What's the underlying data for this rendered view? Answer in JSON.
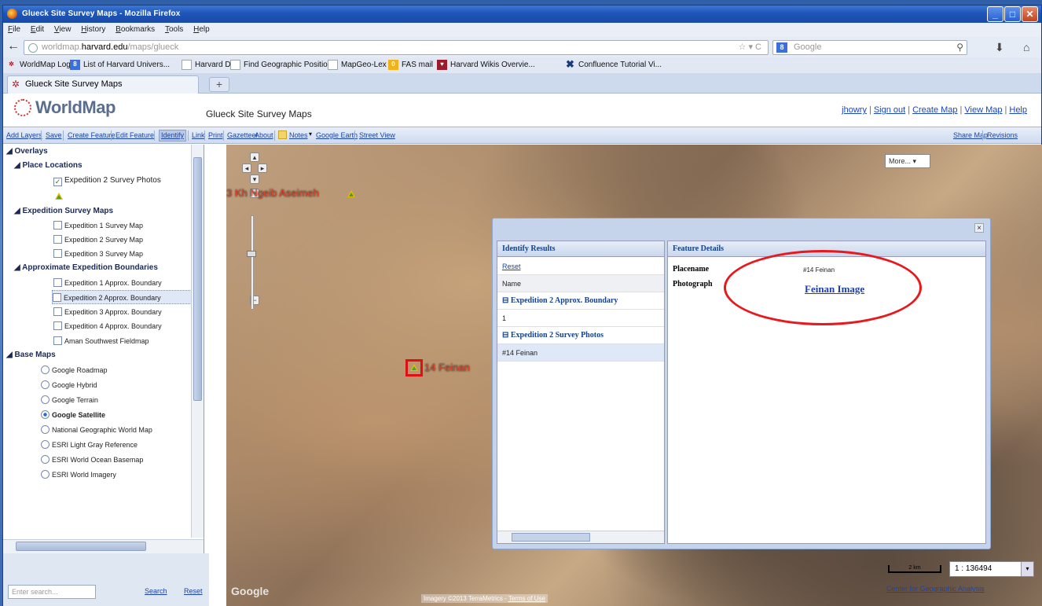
{
  "window": {
    "title": "Glueck Site Survey Maps - Mozilla Firefox"
  },
  "menubar": [
    "File",
    "Edit",
    "View",
    "History",
    "Bookmarks",
    "Tools",
    "Help"
  ],
  "address": {
    "prefix": "worldmap.",
    "host": "harvard.edu",
    "path": "/maps/glueck"
  },
  "search": {
    "placeholder": "Google"
  },
  "bookmarks": [
    "WorldMap Login",
    "List of Harvard Univers...",
    "Harvard Dir",
    "Find Geographic Position",
    "MapGeo-Lex",
    "FAS mail",
    "Harvard Wikis Overvie...",
    "Confluence Tutorial Vi..."
  ],
  "tab": {
    "label": "Glueck Site Survey Maps"
  },
  "header": {
    "logo": "WorldMap",
    "map_title": "Glueck Site Survey Maps",
    "user_links": [
      "jhowry",
      "Sign out",
      "Create Map",
      "View Map",
      "Help"
    ]
  },
  "toolbar": [
    "Add Layers",
    "Save",
    "Create Feature",
    "Edit Feature",
    "Identify",
    "Link",
    "Print",
    "Gazetteer",
    "About",
    "Notes",
    "Google Earth",
    "Street View",
    "Share Map",
    "Revisions"
  ],
  "tree": {
    "overlays": "Overlays",
    "place_locations": "Place Locations",
    "exp2_photos": "Expedition 2 Survey Photos",
    "survey_maps": "Expedition Survey Maps",
    "map1": "Expedition 1 Survey Map",
    "map2": "Expedition 2 Survey Map",
    "map3": "Expedition 3 Survey Map",
    "boundaries": "Approximate Expedition Boundaries",
    "b1": "Expedition 1 Approx. Boundary",
    "b2": "Expedition 2 Approx. Boundary",
    "b3": "Expedition 3 Approx. Boundary",
    "b4": "Expedition 4 Approx. Boundary",
    "aman": "Aman Southwest Fieldmap",
    "base_maps": "Base Maps",
    "bm": [
      "Google Roadmap",
      "Google Hybrid",
      "Google Terrain",
      "Google Satellite",
      "National Geographic World Map",
      "ESRI Light Gray Reference",
      "ESRI World Ocean Basemap",
      "ESRI World Imagery"
    ]
  },
  "sidebar_bottom": {
    "placeholder": "Enter search...",
    "search": "Search",
    "reset": "Reset"
  },
  "map": {
    "label1": "3 Kh Ngeib Aseimeh",
    "label2": "14 Feinan",
    "more": "More...",
    "attribution": "Imagery ©2013 TerraMetrics - ",
    "terms": "Terms of Use",
    "google": "Google",
    "scale_label": "2 km",
    "scale": "1 : 136494",
    "center_link": "Center for Geographic Analysis"
  },
  "identify": {
    "title": "Identify Results",
    "reset": "Reset",
    "name_col": "Name",
    "group1": "Expedition 2 Approx. Boundary",
    "group1_val": "1",
    "group2": "Expedition 2 Survey Photos",
    "group2_val": "#14 Feinan"
  },
  "feature": {
    "title": "Feature Details",
    "placename_label": "Placename",
    "placename_value": "#14 Feinan",
    "photograph_label": "Photograph",
    "link": "Feinan Image"
  },
  "colors": {
    "titlebar": "#1f55b8",
    "link": "#1c3fb0",
    "highlight_ellipse": "#e8181c"
  }
}
